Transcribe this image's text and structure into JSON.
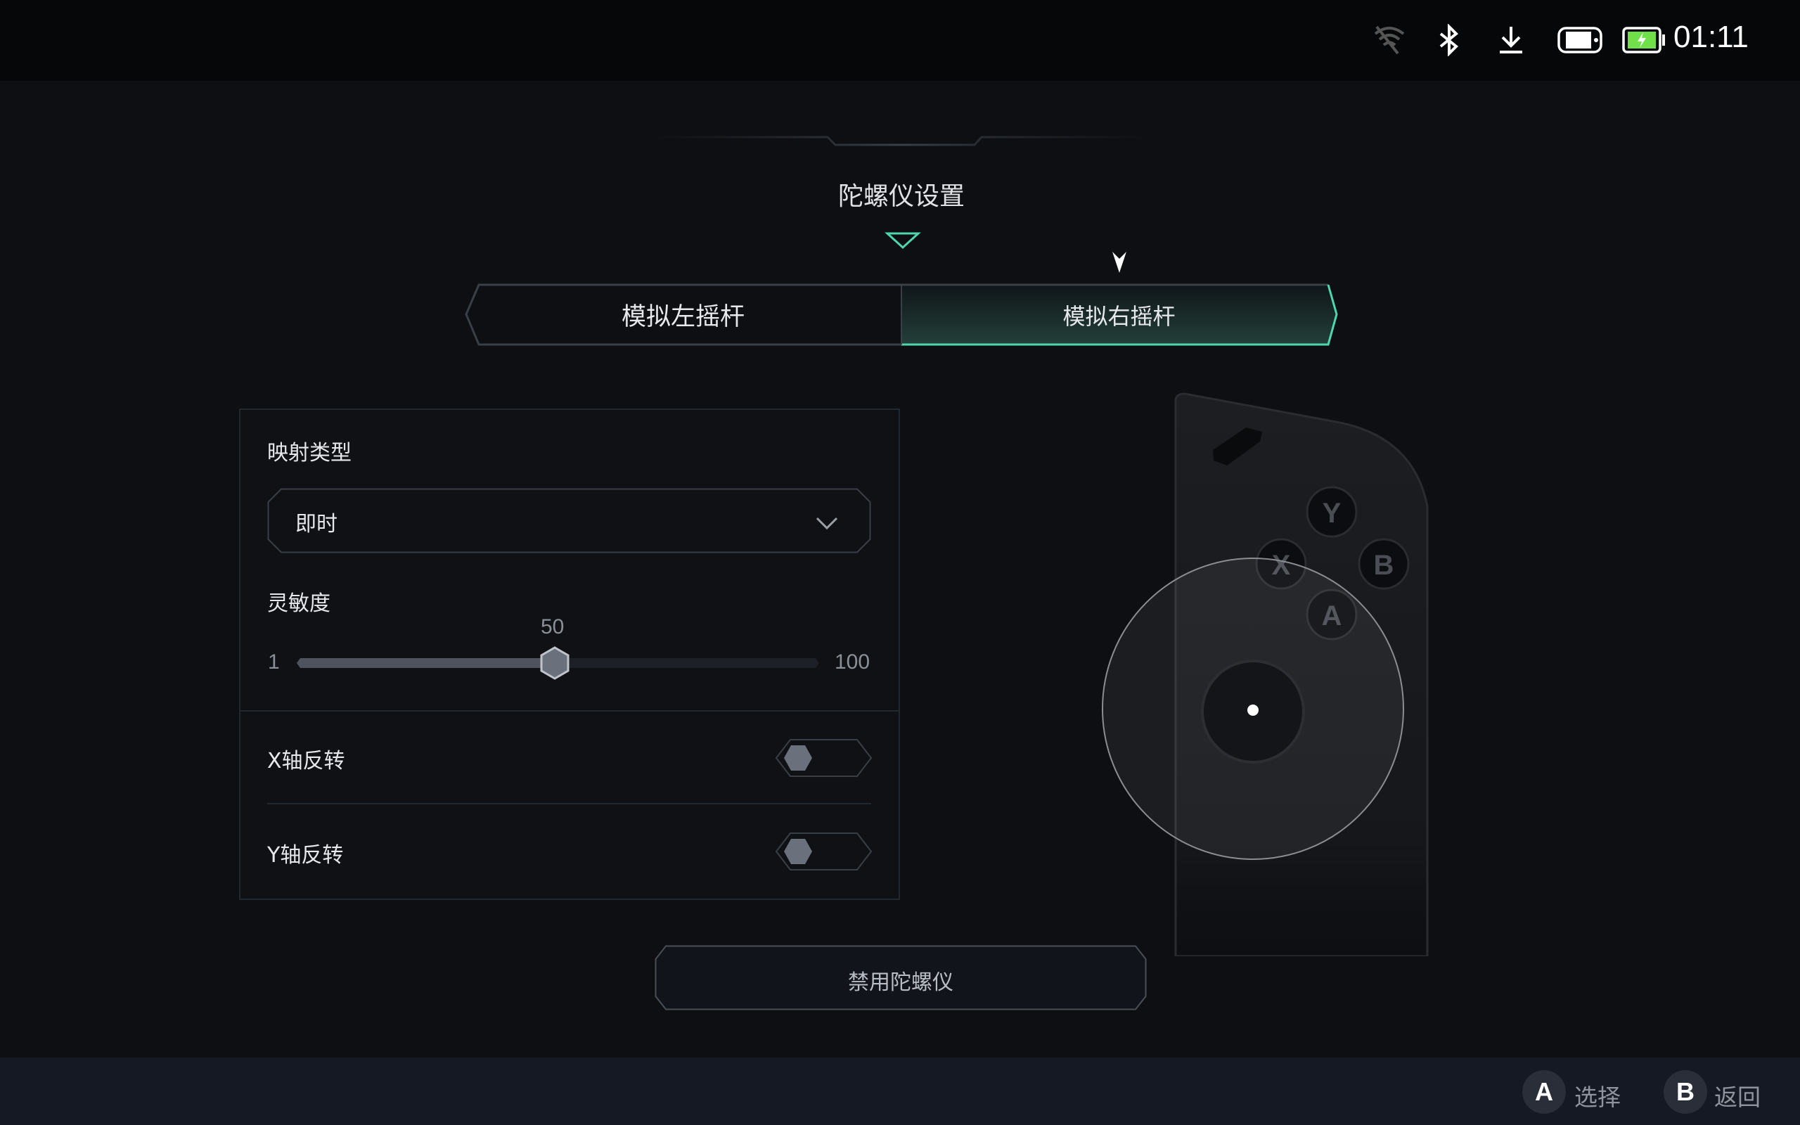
{
  "status_bar": {
    "icons": [
      "wifi-off-icon",
      "bluetooth-icon",
      "download-icon",
      "handheld-mode-icon",
      "battery-charging-icon"
    ],
    "time": "01:11",
    "battery_color": "#6fe04a"
  },
  "header": {
    "title": "陀螺仪设置"
  },
  "tabs": [
    {
      "label": "模拟左摇杆",
      "selected": false
    },
    {
      "label": "模拟右摇杆",
      "selected": true
    }
  ],
  "accent_color": "#4fd6ad",
  "settings": {
    "mapping_type": {
      "label": "映射类型",
      "value": "即时"
    },
    "sensitivity": {
      "label": "灵敏度",
      "value": "50",
      "min": "1",
      "max": "100"
    },
    "x_invert": {
      "label": "X轴反转",
      "on": false
    },
    "y_invert": {
      "label": "Y轴反转",
      "on": false
    }
  },
  "controller": {
    "buttons": [
      "Y",
      "X",
      "B",
      "A"
    ]
  },
  "disable_button": "禁用陀螺仪",
  "footer": {
    "hints": [
      {
        "key": "A",
        "label": "选择"
      },
      {
        "key": "B",
        "label": "返回"
      }
    ]
  }
}
